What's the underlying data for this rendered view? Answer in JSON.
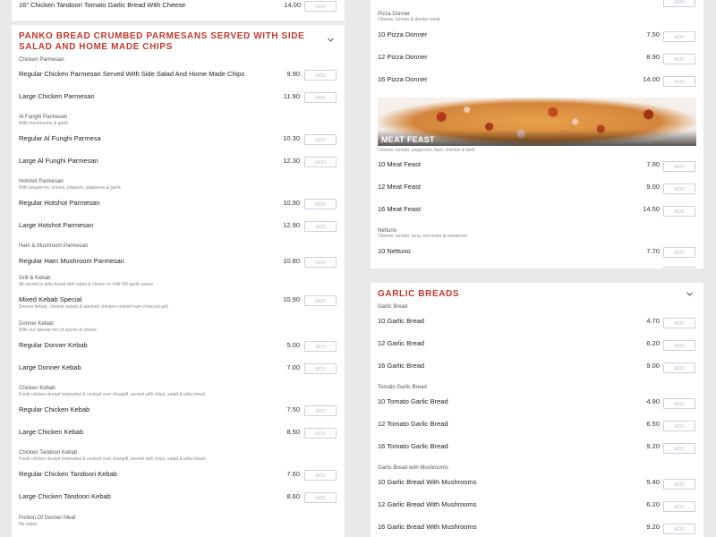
{
  "add_label": "ADD",
  "accent_color": "#c0392b",
  "left": {
    "top_item": {
      "name": "16\" Chicken Tandoori Tomato Garlic Bread With Cheese",
      "price": "14.00"
    },
    "section": {
      "title": "PANKO BREAD CRUMBED PARMESANS SERVED WITH SIDE SALAD AND HOME MADE CHIPS",
      "icon": "chevron-down-icon"
    },
    "groups": [
      {
        "label": "Chicken Parmesan",
        "desc": "",
        "items": [
          {
            "name": "Regular Chicken Parmesan Served With Side Salad And Home Made Chips",
            "price": "9.90"
          },
          {
            "name": "Large Chicken Parmesan",
            "price": "11.90"
          }
        ]
      },
      {
        "label": "Al Funghi Parmesan",
        "desc": "With mushrooms & garlic",
        "items": [
          {
            "name": "Regular Al Funghi Parmesa",
            "price": "10.30"
          },
          {
            "name": "Large Al Funghi Parmesan",
            "price": "12.30"
          }
        ]
      },
      {
        "label": "Hotshot Parmesan",
        "desc": "With pepperoni, onions, peppers, jalapenos & garlic",
        "items": [
          {
            "name": "Regular Hotshot Parmesan",
            "price": "10.90"
          },
          {
            "name": "Large Hotshot Parmesan",
            "price": "12.90"
          }
        ]
      },
      {
        "label": "Ham & Mushroom Parmesan",
        "desc": "",
        "items": [
          {
            "name": "Regular Ham Mushroom Parmesan",
            "price": "10.80"
          }
        ]
      },
      {
        "label": "Grill & Kebab",
        "desc": "All served in pitta bread with salad & choice of chilli OR garlic sauce",
        "items": [
          {
            "name": "Mixed Kebab Special",
            "desc": "Donner kebab, chicken kebab & tandoori chicken cooked over charcoal grill",
            "price": "10.90"
          }
        ]
      },
      {
        "label": "Donner Kebab",
        "desc": "With our special mix of spices & onions",
        "items": [
          {
            "name": "Regular Donner Kebab",
            "price": "5.00"
          },
          {
            "name": "Large Donner Kebab",
            "price": "7.00"
          }
        ]
      },
      {
        "label": "Chicken Kebab",
        "desc": "Fresh chicken breast marinated & cooked over chargrill, served with chips, salad & pitta bread",
        "items": [
          {
            "name": "Regular Chicken Kebab",
            "price": "7.50"
          },
          {
            "name": "Large Chicken Kebab",
            "price": "8.50"
          }
        ]
      },
      {
        "label": "Chicken Tandoori Kebab",
        "desc": "Fresh chicken breast marinated & cooked over chargrill, served with chips, salad & pitta bread",
        "items": [
          {
            "name": "Regular Chicken Tandoori Kebab",
            "price": "7.60"
          },
          {
            "name": "Large Chicken Tandoori Kebab",
            "price": "8.60"
          }
        ]
      },
      {
        "label": "Portion Of Donner Meat",
        "desc": "No salad",
        "items": []
      }
    ]
  },
  "right": {
    "pizza_donner": {
      "label": "Pizza Donner",
      "desc": "Cheese, tomato & donner meat",
      "items": [
        {
          "name": "10 Pizza Donner",
          "price": "7.50"
        },
        {
          "name": "12 Pizza Donner",
          "price": "8.90"
        },
        {
          "name": "16 Pizza Donner",
          "price": "14.00"
        }
      ]
    },
    "meat_feast": {
      "banner_title": "MEAT FEAST",
      "desc": "Cheese, tomato, pepperoni, ham, chicken & beef",
      "items": [
        {
          "name": "10 Meat Feast",
          "price": "7.90"
        },
        {
          "name": "12 Meat Feast",
          "price": "9.00"
        },
        {
          "name": "16 Meat Feast",
          "price": "14.50"
        }
      ]
    },
    "nettuno": {
      "label": "Nettuno",
      "desc": "Cheese, tomato, tuna, red onion & sweetcorn",
      "items": [
        {
          "name": "10 Nettuno",
          "price": "7.70"
        }
      ]
    },
    "garlic_section": {
      "title": "GARLIC BREADS",
      "icon": "chevron-down-icon"
    },
    "garlic_groups": [
      {
        "label": "Garlic Bread",
        "items": [
          {
            "name": "10 Garlic Bread",
            "price": "4.70"
          },
          {
            "name": "12 Garlic Bread",
            "price": "6.20"
          },
          {
            "name": "16 Garlic Bread",
            "price": "9.00"
          }
        ]
      },
      {
        "label": "Tomato Garlic Bread",
        "items": [
          {
            "name": "10 Tomato Garlic Bread",
            "price": "4.90"
          },
          {
            "name": "12 Tomato Garlic Bread",
            "price": "6.50"
          },
          {
            "name": "16 Tomato Garlic Bread",
            "price": "9.20"
          }
        ]
      },
      {
        "label": "Garlic Bread with Mushrooms",
        "items": [
          {
            "name": "10 Garlic Bread With Mushrooms",
            "price": "5.40"
          },
          {
            "name": "12 Garlic Bread With Mushrooms",
            "price": "6.20"
          },
          {
            "name": "16 Garlic Bread With Mushrooms",
            "price": "9.20"
          }
        ]
      }
    ]
  }
}
